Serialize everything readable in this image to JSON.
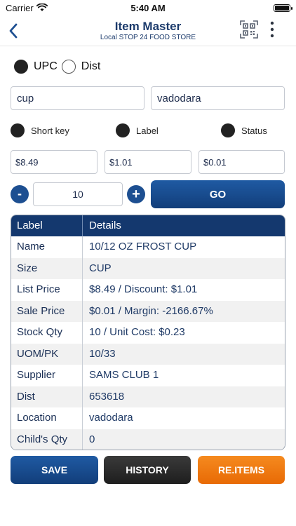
{
  "status_bar": {
    "carrier": "Carrier",
    "time": "5:40 AM"
  },
  "header": {
    "title": "Item Master",
    "subtitle": "Local STOP 24 FOOD STORE"
  },
  "search_mode": {
    "options": [
      "UPC",
      "Dist"
    ],
    "selected": "UPC"
  },
  "inputs": {
    "search_value": "cup",
    "location_value": "vadodara"
  },
  "print_options": [
    "Short key",
    "Label",
    "Status"
  ],
  "prices": {
    "list_price": "$8.49",
    "discount": "$1.01",
    "sale_price": "$0.01"
  },
  "quantity": {
    "minus": "-",
    "value": "10",
    "plus": "+"
  },
  "go_label": "GO",
  "table": {
    "headers": [
      "Label",
      "Details"
    ],
    "rows": [
      {
        "label": "Name",
        "value": "10/12 OZ FROST CUP"
      },
      {
        "label": "Size",
        "value": "CUP"
      },
      {
        "label": "List Price",
        "value": "$8.49 / Discount: $1.01"
      },
      {
        "label": "Sale Price",
        "value": "$0.01 / Margin: -2166.67%"
      },
      {
        "label": "Stock Qty",
        "value": "10 / Unit Cost: $0.23"
      },
      {
        "label": "UOM/PK",
        "value": "10/33"
      },
      {
        "label": "Supplier",
        "value": "SAMS CLUB 1"
      },
      {
        "label": "Dist",
        "value": "653618"
      },
      {
        "label": "Location",
        "value": "vadodara"
      },
      {
        "label": "Child's Qty",
        "value": "0"
      }
    ]
  },
  "buttons": {
    "save": "SAVE",
    "history": "HISTORY",
    "reitems": "RE.ITEMS"
  },
  "colors": {
    "primary": "#14386e",
    "accent_blue": "#1d4f91",
    "history": "#2b2b2b",
    "reitems": "#f07a10"
  }
}
